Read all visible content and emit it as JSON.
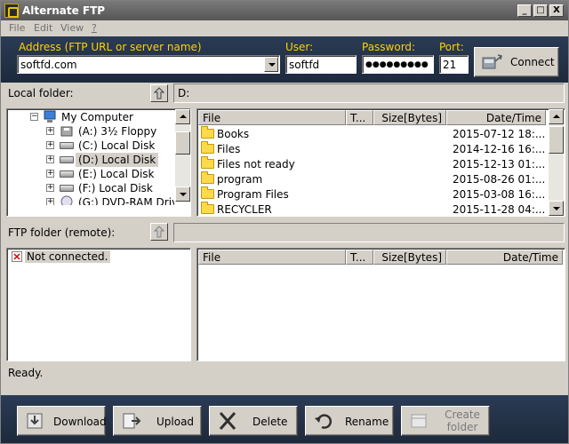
{
  "window": {
    "title": "Alternate FTP",
    "minimize": "_",
    "maximize": "□",
    "close": "X"
  },
  "menu": [
    "File",
    "Edit",
    "View",
    "?"
  ],
  "connection": {
    "address_label": "Address (FTP URL or server name)",
    "address_value": "softfd.com",
    "user_label": "User:",
    "user_value": "softfd",
    "password_label": "Password:",
    "password_value": "●●●●●●●●●",
    "port_label": "Port:",
    "port_value": "21",
    "connect_label": "Connect"
  },
  "local": {
    "label": "Local folder:",
    "path": "D:",
    "tree": [
      {
        "label": "My Computer",
        "icon": "computer-icon"
      },
      {
        "label": "(A:) 3½ Floppy",
        "icon": "floppy-icon"
      },
      {
        "label": "(C:) Local Disk",
        "icon": "drive-icon"
      },
      {
        "label": "(D:) Local Disk",
        "icon": "drive-icon",
        "selected": true
      },
      {
        "label": "(E:) Local Disk",
        "icon": "drive-icon"
      },
      {
        "label": "(F:) Local Disk",
        "icon": "drive-icon"
      },
      {
        "label": "(G:) DVD-RAM Drive",
        "icon": "dvd-icon"
      }
    ],
    "columns": [
      "File",
      "T...",
      "Size[Bytes]",
      "Date/Time"
    ],
    "files": [
      {
        "name": "Books",
        "date": "2015-07-12 18:..."
      },
      {
        "name": "Files",
        "date": "2014-12-16 16:..."
      },
      {
        "name": "Files not ready",
        "date": "2015-12-13 01:..."
      },
      {
        "name": "program",
        "date": "2015-08-26 01:..."
      },
      {
        "name": "Program Files",
        "date": "2015-03-08 16:..."
      },
      {
        "name": "RECYCLER",
        "date": "2015-11-28 04:..."
      }
    ]
  },
  "remote": {
    "label": "FTP folder (remote):",
    "path": "",
    "tree_status": "Not connected.",
    "columns": [
      "File",
      "T...",
      "Size[Bytes]",
      "Date/Time"
    ]
  },
  "status": "Ready.",
  "actions": [
    {
      "label": "Download",
      "icon": "download-icon"
    },
    {
      "label": "Upload",
      "icon": "upload-icon"
    },
    {
      "label": "Delete",
      "icon": "delete-icon"
    },
    {
      "label": "Rename",
      "icon": "rename-icon"
    },
    {
      "label": "Create\nfolder",
      "icon": "create-folder-icon",
      "disabled": true
    }
  ],
  "colors": {
    "accent_label": "#ffd200",
    "panel": "#1d2a3c",
    "window": "#d4d0c8"
  }
}
